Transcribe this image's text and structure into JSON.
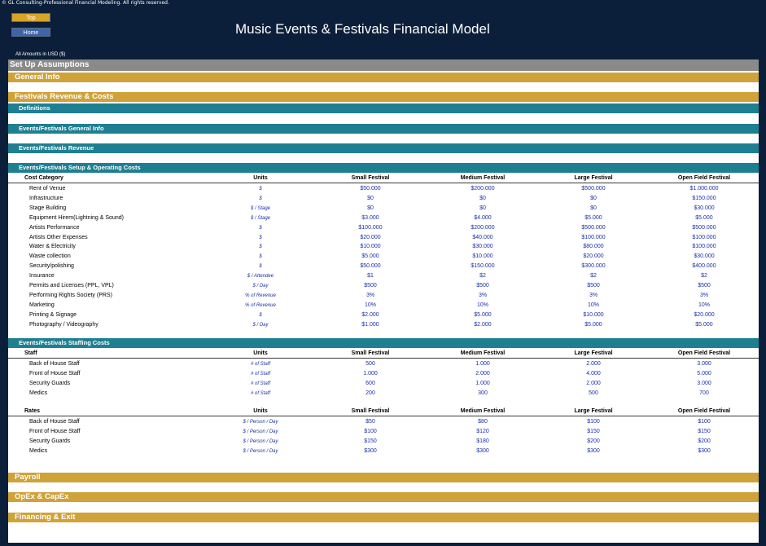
{
  "copyright": "© GL Consulting-Professional Financial Modeling. All rights reserved.",
  "nav": {
    "top_label": "Top",
    "home_label": "Home"
  },
  "title": "Music Events & Festivals Financial Model",
  "amounts_note": "All Amounts in  USD ($)",
  "sections": {
    "setup": "Set Up Assumptions",
    "general_info": "General Info",
    "revenue_costs": "Festivals Revenue & Costs",
    "definitions": "Definitions",
    "events_general": "Events/Festivals General Info",
    "events_revenue": "Events/Festivals Revenue",
    "events_setup": "Events/Festivals Setup & Operating Costs",
    "events_staffing": "Events/Festivals Staffing Costs",
    "payroll": "Payroll",
    "opex": "OpEx & CapEx",
    "financing": "Financing & Exit"
  },
  "columns": [
    "Units",
    "Small Festival",
    "Medium Festival",
    "Large Festival",
    "Open Field Festival"
  ],
  "costs": {
    "header": "Cost Category",
    "rows": [
      {
        "label": "Rent of Venue",
        "units": "$",
        "v": [
          "$50.000",
          "$200.000",
          "$500.000",
          "$1.000.000"
        ]
      },
      {
        "label": "Infrastructure",
        "units": "$",
        "v": [
          "$0",
          "$0",
          "$0",
          "$150.000"
        ]
      },
      {
        "label": "Stage Building",
        "units": "$ / Stage",
        "v": [
          "$0",
          "$0",
          "$0",
          "$30.000"
        ]
      },
      {
        "label": "Equipment Hirem(Lightning & Sound)",
        "units": "$ / Stage",
        "v": [
          "$3.000",
          "$4.000",
          "$5.000",
          "$5.000"
        ]
      },
      {
        "label": "Artists Performance",
        "units": "$",
        "v": [
          "$100.000",
          "$200.000",
          "$500.000",
          "$500.000"
        ]
      },
      {
        "label": "Artists Other Expenses",
        "units": "$",
        "v": [
          "$20.000",
          "$40.000",
          "$100.000",
          "$100.000"
        ]
      },
      {
        "label": "Water & Electricity",
        "units": "$",
        "v": [
          "$10.000",
          "$30.000",
          "$80.000",
          "$100.000"
        ]
      },
      {
        "label": "Waste collection",
        "units": "$",
        "v": [
          "$5.000",
          "$10.000",
          "$20.000",
          "$30.000"
        ]
      },
      {
        "label": "Security/polishing",
        "units": "$",
        "v": [
          "$50.000",
          "$150.000",
          "$300.000",
          "$400.000"
        ]
      },
      {
        "label": "Insurance",
        "units": "$ / Attendee",
        "v": [
          "$1",
          "$2",
          "$2",
          "$2"
        ]
      },
      {
        "label": "Permits and Licenses (PPL, VPL)",
        "units": "$ / Day",
        "v": [
          "$500",
          "$500",
          "$500",
          "$500"
        ]
      },
      {
        "label": "Performing Rights Society (PRS)",
        "units": "% of Revenue",
        "v": [
          "3%",
          "3%",
          "3%",
          "3%"
        ]
      },
      {
        "label": "Marketing",
        "units": "% of Revenue",
        "v": [
          "10%",
          "10%",
          "10%",
          "10%"
        ]
      },
      {
        "label": "Printing & Signage",
        "units": "$",
        "v": [
          "$2.000",
          "$5.000",
          "$10.000",
          "$20.000"
        ]
      },
      {
        "label": "Photography / Videography",
        "units": "$ / Day",
        "v": [
          "$1.000",
          "$2.000",
          "$5.000",
          "$5.000"
        ]
      }
    ]
  },
  "staff": {
    "header": "Staff",
    "rows": [
      {
        "label": "Back of House Staff",
        "units": "# of Staff",
        "v": [
          "500",
          "1.000",
          "2.000",
          "3.000"
        ]
      },
      {
        "label": "Front of House Staff",
        "units": "# of Staff",
        "v": [
          "1.000",
          "2.000",
          "4.000",
          "5.000"
        ]
      },
      {
        "label": "Security Guards",
        "units": "# of Staff",
        "v": [
          "600",
          "1.000",
          "2.000",
          "3.000"
        ]
      },
      {
        "label": "Medics",
        "units": "# of Staff",
        "v": [
          "200",
          "300",
          "500",
          "700"
        ]
      }
    ]
  },
  "rates": {
    "header": "Rates",
    "rows": [
      {
        "label": "Back of House Staff",
        "units": "$ / Person / Day",
        "v": [
          "$50",
          "$80",
          "$100",
          "$100"
        ]
      },
      {
        "label": "Front of House Staff",
        "units": "$ / Person / Day",
        "v": [
          "$100",
          "$120",
          "$150",
          "$150"
        ]
      },
      {
        "label": "Security Guards",
        "units": "$ / Person / Day",
        "v": [
          "$150",
          "$180",
          "$200",
          "$200"
        ]
      },
      {
        "label": "Medics",
        "units": "$ / Person / Day",
        "v": [
          "$300",
          "$300",
          "$300",
          "$300"
        ]
      }
    ]
  }
}
